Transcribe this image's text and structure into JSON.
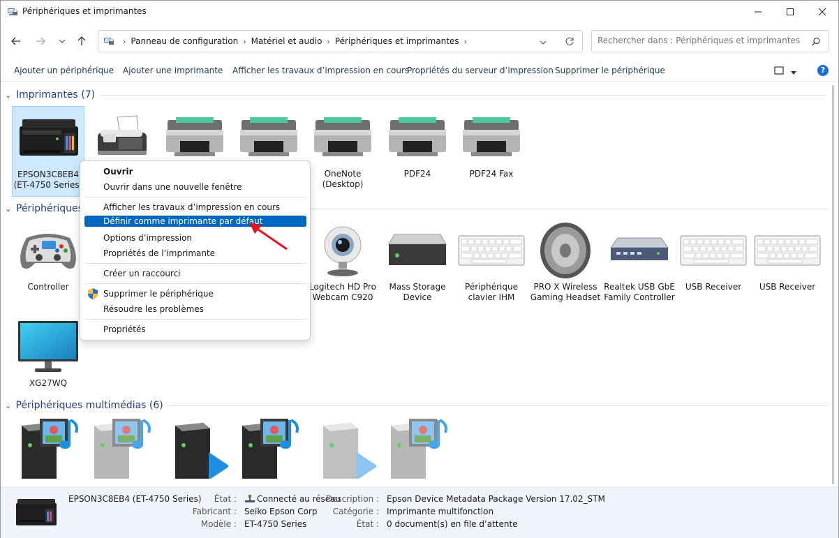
{
  "window": {
    "title": "Périphériques et imprimantes"
  },
  "address": {
    "crumbs": [
      "Panneau de configuration",
      "Matériel et audio",
      "Périphériques et imprimantes"
    ]
  },
  "search": {
    "placeholder": "Rechercher dans : Périphériques et imprimantes"
  },
  "commands": [
    "Ajouter un périphérique",
    "Ajouter une imprimante",
    "Afficher les travaux d’impression en cours",
    "Propriétés du serveur d’impression",
    "Supprimer le périphérique"
  ],
  "sections": {
    "printers": "Imprimantes (7)",
    "devices": "Périphériques",
    "multimedia": "Périphériques multimédias (6)"
  },
  "printers": [
    {
      "name": "EPSON3C8EB4\n(ET-4750 Series)"
    },
    {
      "name": ""
    },
    {
      "name": ""
    },
    {
      "name": ""
    },
    {
      "name": "OneNote\n(Desktop)"
    },
    {
      "name": "PDF24"
    },
    {
      "name": "PDF24 Fax"
    }
  ],
  "devices": [
    {
      "name": "Controller"
    },
    {
      "name": "Logitech HD Pro\nWebcam C920"
    },
    {
      "name": "Mass Storage\nDevice"
    },
    {
      "name": "Périphérique\nclavier IHM"
    },
    {
      "name": "PRO X Wireless\nGaming Headset"
    },
    {
      "name": "Realtek USB GbE\nFamily Controller"
    },
    {
      "name": "USB Receiver"
    },
    {
      "name": "USB Receiver"
    },
    {
      "name": "XG27WQ"
    }
  ],
  "context_menu": {
    "items": [
      "Ouvrir",
      "Ouvrir dans une nouvelle fenêtre",
      "Afficher les travaux d’impression en cours",
      "Définir comme imprimante par défaut",
      "Options d’impression",
      "Propriétés de l’imprimante",
      "Créer un raccourci",
      "Supprimer le périphérique",
      "Résoudre les problèmes",
      "Propriétés"
    ],
    "highlighted": "Définir comme imprimante par défaut"
  },
  "details": {
    "device_name": "EPSON3C8EB4 (ET-4750 Series)",
    "labels": {
      "state": "État :",
      "manufacturer": "Fabricant :",
      "model": "Modèle :",
      "description": "Description :",
      "category": "Catégorie :",
      "status": "État :"
    },
    "values": {
      "state": "Connecté au réseau",
      "manufacturer": "Seiko Epson Corp",
      "model": "ET-4750 Series",
      "description": "Epson Device Metadata Package Version 17.02_STM",
      "category": "Imprimante multifonction",
      "status": "0 document(s) en file d’attente"
    }
  },
  "colors": {
    "accent": "#0067c0",
    "section": "#1e3e88",
    "selection": "#cde8ff",
    "arrow": "#e81123"
  }
}
